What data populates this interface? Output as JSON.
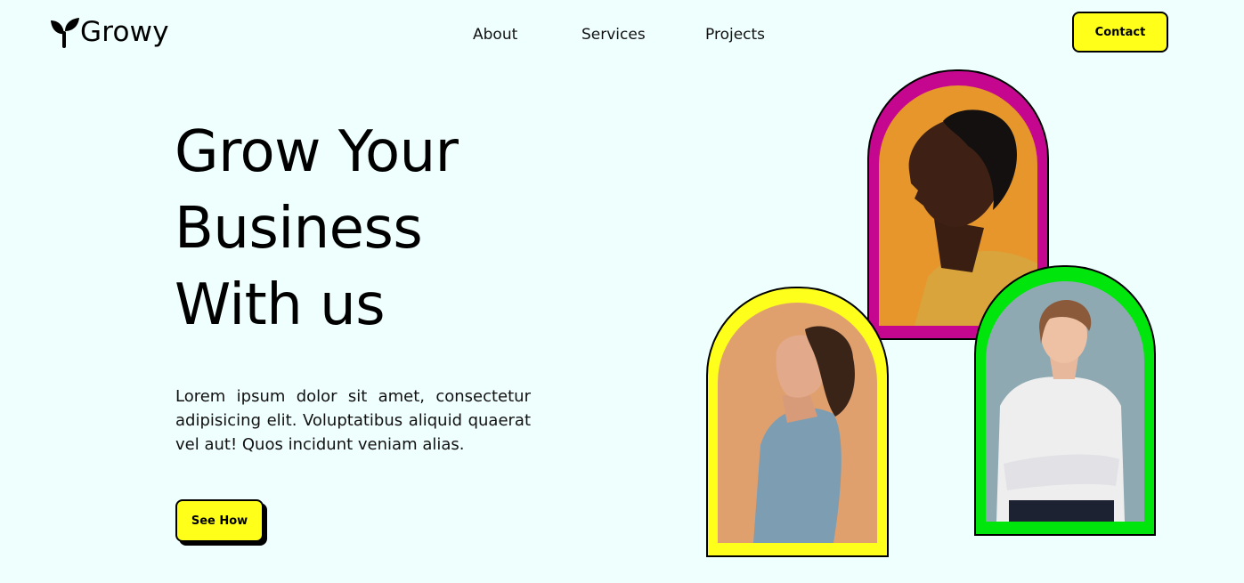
{
  "brand": {
    "name": "Growy",
    "icon": "sprout-icon"
  },
  "nav": {
    "items": [
      "About",
      "Services",
      "Projects"
    ],
    "contact_label": "Contact"
  },
  "hero": {
    "title_lines": [
      "Grow Your",
      "Business",
      "With us"
    ],
    "description": "Lorem ipsum dolor sit amet, consectetur adipisicing elit. Voluptatibus aliquid quaerat vel aut! Quos incidunt veniam alias.",
    "cta_label": "See How"
  },
  "portraits": [
    {
      "subject": "man-profile-photo",
      "frame_color": "#c5078f",
      "background_color": "#e6962b"
    },
    {
      "subject": "curly-hair-man-photo",
      "frame_color": "#ffff1c",
      "background_color": "#e0a06e"
    },
    {
      "subject": "smiling-woman-photo",
      "frame_color": "#00e60c",
      "background_color": "#8fa9b3"
    }
  ],
  "colors": {
    "page_background": "#effffe",
    "accent_yellow": "#ffff1a",
    "text": "#000000"
  }
}
